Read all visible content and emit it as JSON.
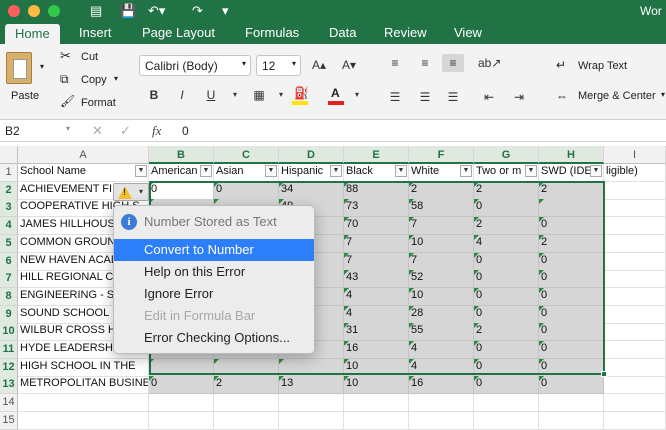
{
  "app": {
    "title": "Wor"
  },
  "colors": {
    "accent": "#217346",
    "menu_highlight": "#2d7ff9"
  },
  "tabs": [
    "Home",
    "Insert",
    "Page Layout",
    "Formulas",
    "Data",
    "Review",
    "View"
  ],
  "ribbon": {
    "paste": "Paste",
    "cut": "Cut",
    "copy": "Copy",
    "format": "Format",
    "font_name": "Calibri (Body)",
    "font_size": "12",
    "wrap_text": "Wrap Text",
    "merge_center": "Merge & Center"
  },
  "formula_bar": {
    "cell_ref": "B2",
    "fx": "fx",
    "value": "0"
  },
  "sheet": {
    "columns": [
      "A",
      "B",
      "C",
      "D",
      "E",
      "F",
      "G",
      "H",
      "I"
    ],
    "row_numbers": [
      "1",
      "2",
      "3",
      "4",
      "5",
      "6",
      "7",
      "8",
      "9",
      "10",
      "11",
      "12",
      "13",
      "14",
      "15"
    ],
    "headers": [
      "School Name",
      "American",
      "Asian",
      "Hispanic",
      "Black",
      "White",
      "Two or m",
      "SWD (IDE",
      "ligible)"
    ],
    "school_names": [
      "ACHIEVEMENT FIRS",
      "COOPERATIVE HIGH S",
      "JAMES HILLHOUSE",
      "COMMON GROUND",
      "NEW HAVEN ACADE",
      "HILL REGIONAL CAR",
      "ENGINEERING - SCIE",
      "SOUND SCHOOL",
      "WILBUR CROSS HIG",
      "HYDE LEADERSHIP S",
      "HIGH SCHOOL IN THE",
      "METROPOLITAN BUSINESS"
    ],
    "rows": [
      [
        "0",
        "0",
        "34",
        "88",
        "2",
        "2",
        "2"
      ],
      [
        "",
        "",
        "49",
        "73",
        "58",
        "0",
        ""
      ],
      [
        "",
        "",
        "",
        "70",
        "7",
        "2",
        "0"
      ],
      [
        "",
        "",
        "",
        "7",
        "10",
        "4",
        "2"
      ],
      [
        "",
        "",
        "",
        "7",
        "7",
        "0",
        "0"
      ],
      [
        "",
        "",
        "",
        "43",
        "52",
        "0",
        "0"
      ],
      [
        "",
        "",
        "",
        "4",
        "10",
        "0",
        "0"
      ],
      [
        "",
        "",
        "",
        "4",
        "28",
        "0",
        "0"
      ],
      [
        "",
        "",
        "",
        "31",
        "55",
        "2",
        "0"
      ],
      [
        "",
        "",
        "",
        "16",
        "4",
        "0",
        "0"
      ],
      [
        "",
        "",
        "",
        "10",
        "4",
        "0",
        "0"
      ],
      [
        "0",
        "2",
        "13",
        "10",
        "16",
        "0",
        "0"
      ]
    ]
  },
  "error_menu": {
    "header": "Number Stored as Text",
    "items": [
      {
        "label": "Convert to Number",
        "state": "highlighted"
      },
      {
        "label": "Help on this Error",
        "state": "normal"
      },
      {
        "label": "Ignore Error",
        "state": "normal"
      },
      {
        "label": "Edit in Formula Bar",
        "state": "disabled"
      },
      {
        "label": "Error Checking Options...",
        "state": "normal"
      }
    ]
  }
}
